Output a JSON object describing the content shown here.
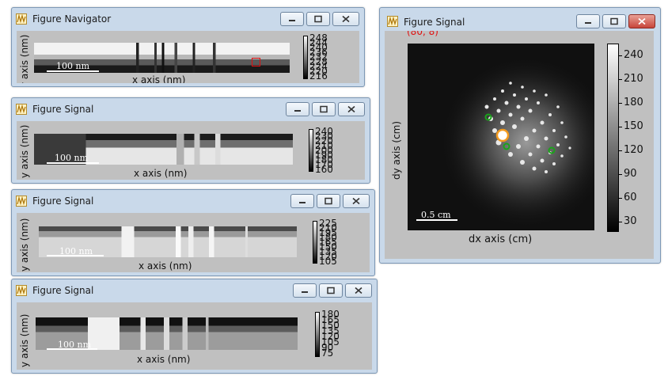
{
  "colors": {
    "window_frame": "#c9d9ea",
    "marker_red": "#e01010",
    "marker_green": "#1aa31a",
    "marker_orange": "#f39a1e"
  },
  "icons": {
    "app": "matplotlib-icon",
    "minimize": "minimize-icon",
    "maximize": "maximize-icon",
    "close": "close-icon"
  },
  "navigator": {
    "title": "Figure Navigator",
    "ylabel": "y axis (nm)",
    "xlabel": "x axis (nm)",
    "scalebar": "100 nm",
    "cbar_ticks": [
      "248",
      "244",
      "240",
      "236",
      "232",
      "228",
      "224",
      "220",
      "216"
    ]
  },
  "signal1": {
    "title": "Figure  Signal",
    "ylabel": "y axis (nm)",
    "xlabel": "x axis (nm)",
    "scalebar": "100 nm",
    "cbar_ticks": [
      "240",
      "230",
      "220",
      "210",
      "200",
      "190",
      "180",
      "170",
      "160"
    ]
  },
  "signal2": {
    "title": "Figure  Signal",
    "ylabel": "y axis (nm)",
    "xlabel": "x axis (nm)",
    "scalebar": "100 nm",
    "cbar_ticks": [
      "225",
      "210",
      "195",
      "180",
      "165",
      "150",
      "135",
      "120",
      "105"
    ]
  },
  "signal3": {
    "title": "Figure  Signal",
    "ylabel": "y axis (nm)",
    "xlabel": "x axis (nm)",
    "scalebar": "100 nm",
    "cbar_ticks": [
      "180",
      "165",
      "150",
      "135",
      "120",
      "105",
      "90",
      "75"
    ]
  },
  "diffraction": {
    "title": "Figure Signal",
    "coord_label": "(80, 8)",
    "ylabel": "dy axis (cm)",
    "xlabel": "dx axis (cm)",
    "scalebar": "0.5 cm",
    "cbar_ticks": [
      "240",
      "210",
      "180",
      "150",
      "120",
      "90",
      "60",
      "30"
    ]
  }
}
